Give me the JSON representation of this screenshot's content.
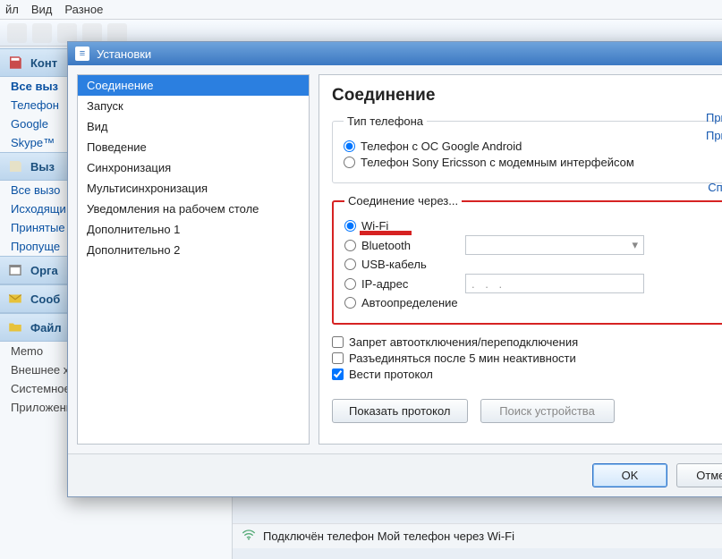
{
  "menu": {
    "file": "йл",
    "view": "Вид",
    "misc": "Разное"
  },
  "left": {
    "contacts": "Конт",
    "allCalls": "Все выз",
    "phone": "Телефон",
    "google": "Google",
    "skype": "Skype™",
    "calls": "Выз",
    "allCalls2": "Все вызо",
    "outgoing": "Исходящи",
    "accepted": "Принятые",
    "missed": "Пропуще",
    "org": "Орга",
    "msg": "Сооб",
    "files": "Файл",
    "memo": "Memo",
    "extStore": "Внешнее хранилище",
    "sysStore": "Системное хранилище",
    "apps": "Приложения"
  },
  "dialog": {
    "title": "Установки",
    "nav": [
      "Соединение",
      "Запуск",
      "Вид",
      "Поведение",
      "Синхронизация",
      "Мультисинхронизация",
      "Уведомления на рабочем столе",
      "Дополнительно 1",
      "Дополнительно 2"
    ]
  },
  "content": {
    "heading": "Соединение",
    "phoneType": {
      "legend": "Тип телефона",
      "android": "Телефон с ОС Google Android",
      "sony": "Телефон Sony Ericsson с модемным интерфейсом",
      "link1": "Приме",
      "link2": "Приме"
    },
    "connVia": {
      "legend": "Соединение через...",
      "wifi": "Wi-Fi",
      "bt": "Bluetooth",
      "usb": "USB-кабель",
      "ip": "IP-адрес",
      "auto": "Автоопределение",
      "help": "Справ"
    },
    "checks": {
      "noAuto": "Запрет автоотключения/переподключения",
      "disc5": "Разъединяться после 5 мин неактивности",
      "log": "Вести протокол"
    },
    "buttons": {
      "showLog": "Показать протокол",
      "find": "Поиск устройства"
    },
    "footer": {
      "ok": "OK",
      "cancel": "Отмен"
    }
  },
  "status": "Подключён телефон Мой телефон через Wi-Fi"
}
